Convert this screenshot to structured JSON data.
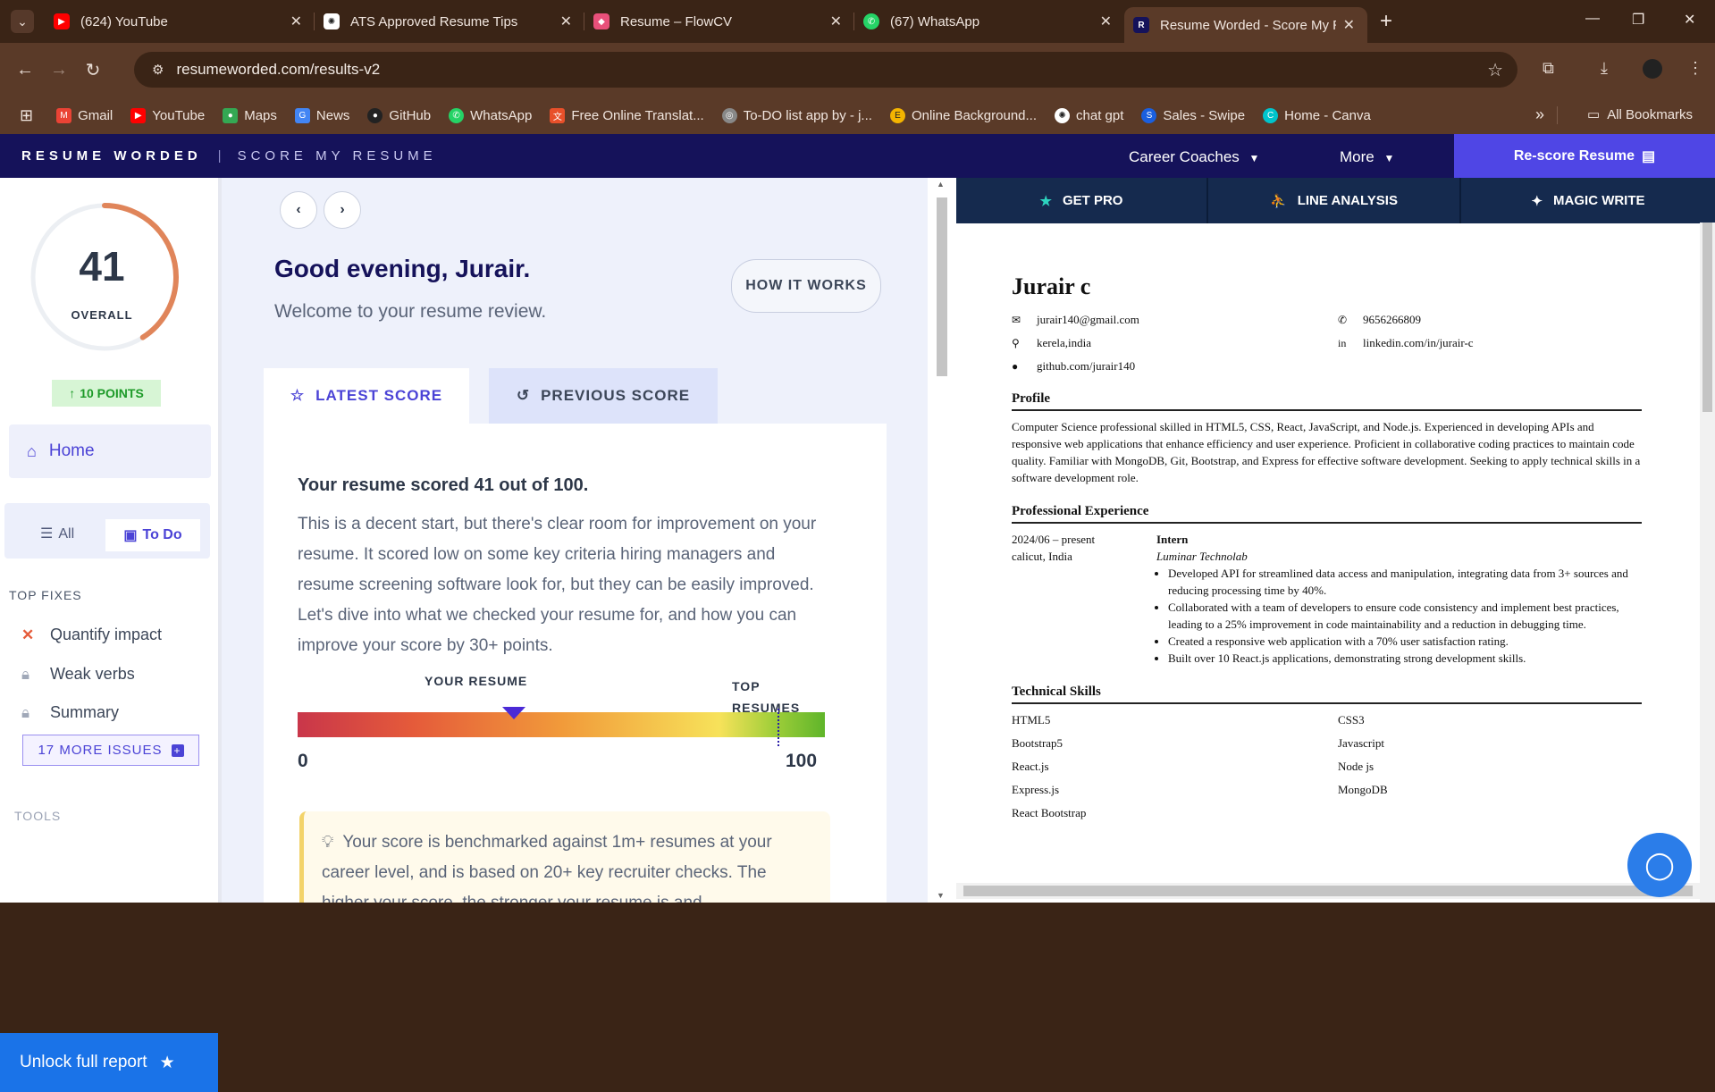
{
  "browser": {
    "tabs": [
      {
        "title": "(624) YouTube",
        "icon": "youtube-icon",
        "color": "#ff0000"
      },
      {
        "title": "ATS Approved Resume Tips",
        "icon": "chatgpt-icon",
        "color": "#ffffff"
      },
      {
        "title": "Resume – FlowCV",
        "icon": "flowcv-icon",
        "color": "#e8507a"
      },
      {
        "title": "(67) WhatsApp",
        "icon": "whatsapp-icon",
        "color": "#25d366"
      },
      {
        "title": "Resume Worded - Score My Re",
        "icon": "resumeworded-icon",
        "color": "#15125a"
      }
    ],
    "url": "resumeworded.com/results-v2",
    "bookmarks": [
      {
        "label": "Gmail",
        "color": "#ea4335"
      },
      {
        "label": "YouTube",
        "color": "#ff0000"
      },
      {
        "label": "Maps",
        "color": "#34a853"
      },
      {
        "label": "News",
        "color": "#4285f4"
      },
      {
        "label": "GitHub",
        "color": "#222222"
      },
      {
        "label": "WhatsApp",
        "color": "#25d366"
      },
      {
        "label": "Free Online Translat...",
        "color": "#e8502a"
      },
      {
        "label": "To-DO list app by - j...",
        "color": "#888888"
      },
      {
        "label": "Online Background...",
        "color": "#f4b400"
      },
      {
        "label": "chat gpt",
        "color": "#ffffff"
      },
      {
        "label": "Sales - Swipe",
        "color": "#1a5fe0"
      },
      {
        "label": "Home - Canva",
        "color": "#00c4cc"
      }
    ],
    "all_bookmarks": "All Bookmarks"
  },
  "site_nav": {
    "brand": "RESUME WORDED",
    "separator": "|",
    "subtitle": "SCORE MY RESUME",
    "career_coaches": "Career Coaches",
    "more": "More",
    "rescore": "Re-score Resume"
  },
  "sidebar": {
    "score": "41",
    "score_label": "OVERALL",
    "score_fraction": 0.41,
    "points": "10 POINTS",
    "home": "Home",
    "toggle_all": "All",
    "toggle_todo": "To Do",
    "top_fixes_heading": "TOP FIXES",
    "fixes": [
      "Quantify impact",
      "Weak verbs",
      "Summary"
    ],
    "more_issues": "17 MORE ISSUES",
    "tools_heading": "TOOLS",
    "unlock": "Unlock full report"
  },
  "main": {
    "greeting": "Good evening, Jurair.",
    "welcome": "Welcome to your resume review.",
    "how_it_works": "HOW IT WORKS",
    "tab_latest": "LATEST SCORE",
    "tab_previous": "PREVIOUS SCORE",
    "score_heading": "Your resume scored 41 out of 100.",
    "score_text": "This is a decent start, but there's clear room for improvement on your resume. It scored low on some key criteria hiring managers and resume screening software look for, but they can be easily improved. Let's dive into what we checked your resume for, and how you can improve your score by 30+ points.",
    "gauge_your_label": "YOUR RESUME",
    "gauge_top_label": "TOP RESUMES",
    "gauge_min": "0",
    "gauge_max": "100",
    "gauge_value": 41,
    "gauge_top_value": 91,
    "tip_text": "Your score is benchmarked against 1m+ resumes at your career level, and is based on 20+ key recruiter checks. The higher your score, the stronger your resume is and..."
  },
  "right_panel": {
    "tab_get_pro": "GET PRO",
    "tab_line_analysis": "LINE ANALYSIS",
    "tab_magic_write": "MAGIC WRITE"
  },
  "resume": {
    "name": "Jurair c",
    "email": "jurair140@gmail.com",
    "phone": "9656266809",
    "location": "kerela,india",
    "linkedin": "linkedin.com/in/jurair-c",
    "github": "github.com/jurair140",
    "profile_heading": "Profile",
    "profile_text": "Computer Science professional skilled in HTML5, CSS, React, JavaScript, and Node.js. Experienced in developing APIs and responsive web applications that enhance efficiency and user experience. Proficient in collaborative coding practices to maintain code quality. Familiar with MongoDB, Git, Bootstrap, and Express for effective software development. Seeking to apply technical skills in a software development role.",
    "experience_heading": "Professional Experience",
    "exp_date": "2024/06 – present",
    "exp_location": "calicut, India",
    "exp_title": "Intern",
    "exp_company": "Luminar Technolab",
    "exp_bullets": [
      "Developed API for streamlined data access and manipulation, integrating data from 3+ sources and reducing processing time by 40%.",
      "Collaborated with a team of developers to ensure code consistency and implement best practices, leading to a 25% improvement in code maintainability and a reduction in debugging time.",
      "Created a responsive web application with a 70% user satisfaction rating.",
      "Built over 10 React.js applications, demonstrating strong development skills."
    ],
    "skills_heading": "Technical Skills",
    "skills": [
      "HTML5",
      "CSS3",
      "Bootstrap5",
      "Javascript",
      "React.js",
      "Node js",
      "Express.js",
      "MongoDB",
      "React Bootstrap"
    ]
  }
}
